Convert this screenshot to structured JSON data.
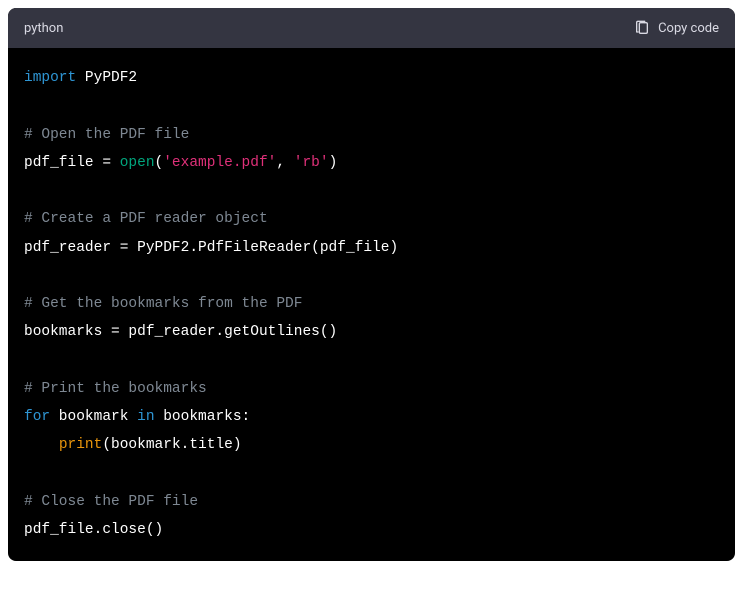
{
  "header": {
    "language": "python",
    "copy_label": "Copy code"
  },
  "code": {
    "l1_kw": "import",
    "l1_mod": " PyPDF2",
    "l3_comment": "# Open the PDF file",
    "l4_a": "pdf_file = ",
    "l4_open": "open",
    "l4_paren1": "(",
    "l4_str1": "'example.pdf'",
    "l4_comma": ", ",
    "l4_str2": "'rb'",
    "l4_paren2": ")",
    "l6_comment": "# Create a PDF reader object",
    "l7": "pdf_reader = PyPDF2.PdfFileReader(pdf_file)",
    "l9_comment": "# Get the bookmarks from the PDF",
    "l10": "bookmarks = pdf_reader.getOutlines()",
    "l12_comment": "# Print the bookmarks",
    "l13_for": "for",
    "l13_var": " bookmark ",
    "l13_in": "in",
    "l13_rest": " bookmarks:",
    "l14_indent": "    ",
    "l14_print": "print",
    "l14_rest": "(bookmark.title)",
    "l16_comment": "# Close the PDF file",
    "l17": "pdf_file.close()"
  }
}
